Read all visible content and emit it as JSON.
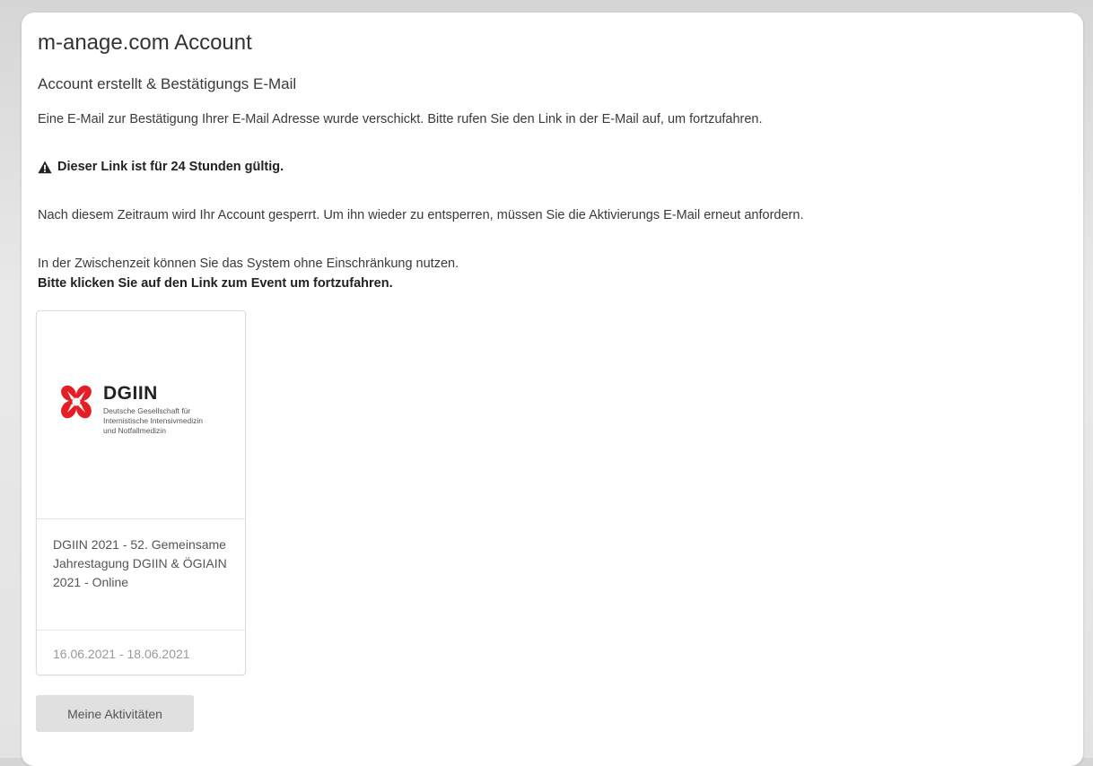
{
  "account": {
    "title": "m-anage.com Account",
    "subtitle": "Account erstellt & Bestätigungs E-Mail",
    "info": "Eine E-Mail zur Bestätigung Ihrer E-Mail Adresse wurde verschickt. Bitte rufen Sie den Link in der E-Mail auf, um fortzufahren.",
    "warning": "Dieser Link ist für 24 Stunden gültig.",
    "lock_notice": "Nach diesem Zeitraum wird Ihr Account gesperrt. Um ihn wieder zu entsperren, müssen Sie die Aktivierungs E-Mail erneut anfordern.",
    "interim_notice": "In der Zwischenzeit können Sie das System ohne Einschränkung nutzen.",
    "cta_notice": "Bitte klicken Sie auf den Link zum Event um fortzufahren."
  },
  "event_card": {
    "logo_name": "DGIIN",
    "logo_subtitle_lines": [
      "Deutsche Gesellschaft für",
      "Internistische Intensivmedizin",
      "und Notfallmedizin"
    ],
    "title": "DGIIN 2021 - 52. Gemeinsame Jahrestagung DGIIN & ÖGIAIN 2021 - Online",
    "dates": "16.06.2021 - 18.06.2021",
    "logo_color": "#e31e24"
  },
  "actions": {
    "my_activities_label": "Meine Aktivitäten"
  },
  "icons": {
    "warning": "warning-triangle-icon",
    "logo": "dgiin-logo-icon"
  }
}
